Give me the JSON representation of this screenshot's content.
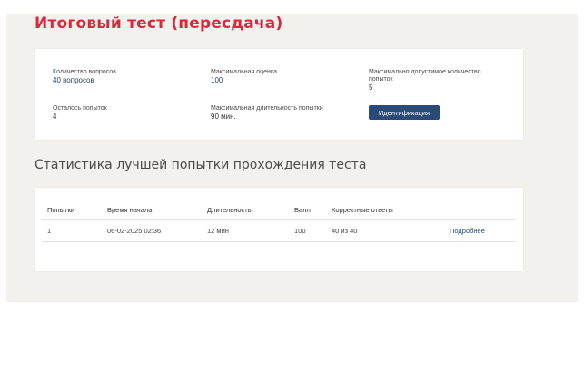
{
  "page": {
    "title": "Итоговый тест (пересдача)"
  },
  "info": {
    "questions": {
      "label": "Количество вопросов",
      "value": "40 вопросов"
    },
    "max_score": {
      "label": "Максимальная оценка",
      "value": "100"
    },
    "max_attempts": {
      "label": "Максимально допустимое количество попыток",
      "value": "5"
    },
    "remaining_attempts": {
      "label": "Осталось попыток",
      "value": "4"
    },
    "max_duration": {
      "label": "Максимальная длительность попытки",
      "value": "90 мин."
    },
    "identify_button": "Идентификация"
  },
  "stats": {
    "title": "Статистика лучшей попытки прохождения теста",
    "columns": [
      "Попытки",
      "Время начала",
      "Длительность",
      "Балл",
      "Корректные ответы"
    ],
    "rows": [
      {
        "attempt": "1",
        "start_time": "06-02-2025 02:36",
        "duration": "12 мин",
        "score": "100",
        "correct": "40 из 40",
        "details_label": "Подробнее"
      }
    ]
  },
  "colors": {
    "accent": "#d8283c",
    "button": "#2b4a78",
    "background": "#f2f1ee"
  }
}
